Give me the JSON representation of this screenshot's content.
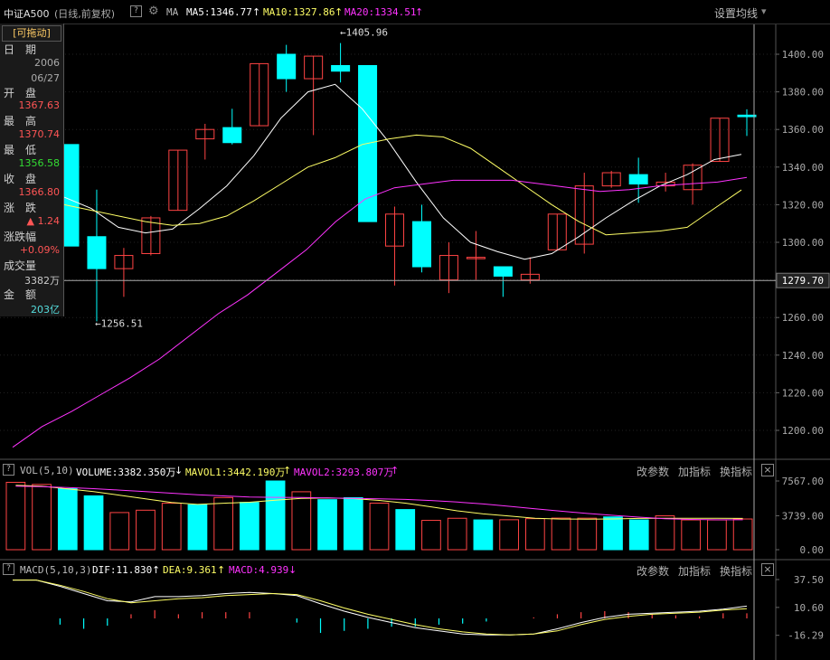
{
  "header": {
    "index_name": "中证A500",
    "period_label": "(日线,前复权)",
    "help_glyph": "?",
    "ma_label": "MA",
    "ma5": "MA5:1346.77",
    "ma10": "MA10:1327.86",
    "ma20": "MA20:1334.51",
    "arrow_up": "↑",
    "settings_label": "设置均线",
    "settings_caret": "▾"
  },
  "info_panel": {
    "drag_label": "[可拖动]",
    "date_label": "日　期",
    "date_year": "2006",
    "date_md": "06/27",
    "open_label": "开　盘",
    "open_value": "1367.63",
    "high_label": "最　高",
    "high_value": "1370.74",
    "low_label": "最　低",
    "low_value": "1356.58",
    "close_label": "收　盘",
    "close_value": "1366.80",
    "change_label": "涨　跌",
    "change_value": "▲ 1.24",
    "pct_label": "涨跌幅",
    "pct_value": "+0.09%",
    "volume_label": "成交量",
    "volume_value": "3382万",
    "amount_label": "金　额",
    "amount_value": "203亿"
  },
  "price_panel": {
    "axis_labels": [
      "1400.00",
      "1380.00",
      "1360.00",
      "1340.00",
      "1320.00",
      "1300.00",
      "1280.00",
      "1260.00",
      "1240.00",
      "1220.00",
      "1200.00"
    ],
    "cursor_value": "1279.70",
    "max_marker": "←1405.96",
    "min_marker": "←1256.51"
  },
  "volume_panel": {
    "title": "VOL(5,10)",
    "volume": "VOLUME:3382.350万",
    "down_arrow": "↓",
    "mavol1": "MAVOL1:3442.190万",
    "mavol2": "MAVOL2:3293.807万",
    "up_arrow": "↑",
    "axis_labels": [
      "7567.00",
      "3739.00",
      "0.00"
    ]
  },
  "macd_panel": {
    "title": "MACD(5,10,3)",
    "dif": "DIF:11.830",
    "dea": "DEA:9.361",
    "macd": "MACD:4.939",
    "up_arrow": "↑",
    "down_arrow": "↓",
    "axis_labels": [
      "37.50",
      "10.60",
      "-16.29"
    ]
  },
  "buttons": {
    "params": "改参数",
    "add_indicator": "加指标",
    "switch_indicator": "换指标",
    "close": "×"
  },
  "colors": {
    "up": "#ff4444",
    "down": "#00ffff",
    "ma5": "#ffffff",
    "ma10": "#ffff66",
    "ma20": "#ff33ff"
  },
  "chart_data": {
    "type": "candlestick",
    "candles": [
      {
        "o": 1352,
        "h": 1352,
        "l": 1298,
        "c": 1298
      },
      {
        "o": 1303,
        "h": 1328,
        "l": 1258,
        "c": 1286
      },
      {
        "o": 1286,
        "h": 1297,
        "l": 1271,
        "c": 1293
      },
      {
        "o": 1294,
        "h": 1314,
        "l": 1293,
        "c": 1313
      },
      {
        "o": 1317,
        "h": 1349,
        "l": 1317,
        "c": 1349
      },
      {
        "o": 1355,
        "h": 1363,
        "l": 1344,
        "c": 1360
      },
      {
        "o": 1361,
        "h": 1371,
        "l": 1352,
        "c": 1353
      },
      {
        "o": 1362,
        "h": 1395,
        "l": 1362,
        "c": 1395
      },
      {
        "o": 1400,
        "h": 1405,
        "l": 1380,
        "c": 1387
      },
      {
        "o": 1387,
        "h": 1399,
        "l": 1357,
        "c": 1399
      },
      {
        "o": 1394,
        "h": 1405.96,
        "l": 1385,
        "c": 1391
      },
      {
        "o": 1394,
        "h": 1394,
        "l": 1311,
        "c": 1311
      },
      {
        "o": 1298,
        "h": 1319,
        "l": 1277,
        "c": 1315
      },
      {
        "o": 1311,
        "h": 1320,
        "l": 1284,
        "c": 1287
      },
      {
        "o": 1280,
        "h": 1300,
        "l": 1273,
        "c": 1293
      },
      {
        "o": 1292,
        "h": 1306,
        "l": 1280,
        "c": 1292
      },
      {
        "o": 1287,
        "h": 1287,
        "l": 1271,
        "c": 1282
      },
      {
        "o": 1280,
        "h": 1292,
        "l": 1278,
        "c": 1283
      },
      {
        "o": 1296,
        "h": 1315,
        "l": 1296,
        "c": 1315
      },
      {
        "o": 1299,
        "h": 1337,
        "l": 1294,
        "c": 1330
      },
      {
        "o": 1330,
        "h": 1338,
        "l": 1329,
        "c": 1337
      },
      {
        "o": 1336,
        "h": 1345,
        "l": 1321,
        "c": 1331
      },
      {
        "o": 1330,
        "h": 1337,
        "l": 1327,
        "c": 1332
      },
      {
        "o": 1328,
        "h": 1342,
        "l": 1320,
        "c": 1341
      },
      {
        "o": 1343,
        "h": 1366,
        "l": 1343,
        "c": 1366
      },
      {
        "o": 1367.63,
        "h": 1370.74,
        "l": 1356.58,
        "c": 1366.8
      }
    ],
    "ma5": [
      1324,
      1318,
      1308,
      1305,
      1307,
      1318,
      1330,
      1346,
      1366,
      1380,
      1384,
      1371,
      1353,
      1332,
      1313,
      1300,
      1295,
      1291,
      1294,
      1303,
      1313,
      1322,
      1330,
      1336,
      1344,
      1346.77
    ],
    "ma10": [
      1320,
      1317,
      1314,
      1311,
      1309,
      1310,
      1314,
      1322,
      1331,
      1340,
      1345,
      1352,
      1355,
      1357,
      1356,
      1350,
      1340,
      1330,
      1320,
      1311,
      1304,
      1305,
      1306,
      1308,
      1318,
      1327.86
    ],
    "ma20": [
      1191,
      1202,
      1210,
      1219,
      1228,
      1238,
      1250,
      1262,
      1272,
      1284,
      1296,
      1311,
      1323,
      1329,
      1331,
      1333,
      1333,
      1333,
      1331,
      1329,
      1327,
      1328,
      1330,
      1331,
      1332,
      1334.51
    ],
    "volume": [
      7420,
      7190,
      6720,
      5930,
      4090,
      4350,
      5120,
      4950,
      5740,
      5210,
      7567,
      6380,
      5510,
      5730,
      5130,
      4420,
      3230,
      3460,
      3280,
      3300,
      3420,
      3480,
      3470,
      3610,
      3280,
      3730,
      3280,
      3280,
      3382
    ],
    "mavol1": [
      7100,
      7000,
      6700,
      6400,
      6000,
      5600,
      5200,
      4990,
      5120,
      5230,
      5450,
      5650,
      5700,
      5630,
      5430,
      5130,
      4720,
      4280,
      3940,
      3700,
      3460,
      3380,
      3370,
      3390,
      3440,
      3450,
      3450,
      3450,
      3442
    ],
    "mavol2": [
      7000,
      6950,
      6850,
      6720,
      6560,
      6400,
      6220,
      6040,
      5920,
      5800,
      5760,
      5740,
      5700,
      5660,
      5600,
      5540,
      5420,
      5250,
      5040,
      4780,
      4500,
      4240,
      3990,
      3780,
      3580,
      3420,
      3340,
      3300,
      3294
    ],
    "macd_dif": [
      37,
      37,
      31,
      24,
      17,
      16,
      21,
      21,
      22,
      24,
      25,
      24,
      22,
      14,
      7,
      1,
      -4,
      -9,
      -12,
      -15,
      -16,
      -16,
      -15,
      -10,
      -4,
      1,
      4,
      5,
      6,
      7,
      9,
      11.83
    ],
    "macd_dea": [
      37,
      37,
      32,
      26,
      19,
      15,
      17,
      19,
      20,
      22,
      23,
      24,
      23,
      17,
      10,
      4,
      -1,
      -6,
      -10,
      -13,
      -15,
      -16,
      -15,
      -12,
      -6,
      -1,
      2,
      4,
      5,
      6,
      8,
      9.361
    ],
    "macd_hist": [
      0,
      0,
      -6,
      -10,
      -7,
      4,
      8,
      4,
      6,
      6,
      6,
      0,
      -4,
      -14,
      -12,
      -10,
      -8,
      -8,
      -6,
      -5,
      -3,
      0,
      1,
      4,
      6,
      7,
      6,
      4,
      3,
      2,
      5,
      4.939
    ]
  }
}
